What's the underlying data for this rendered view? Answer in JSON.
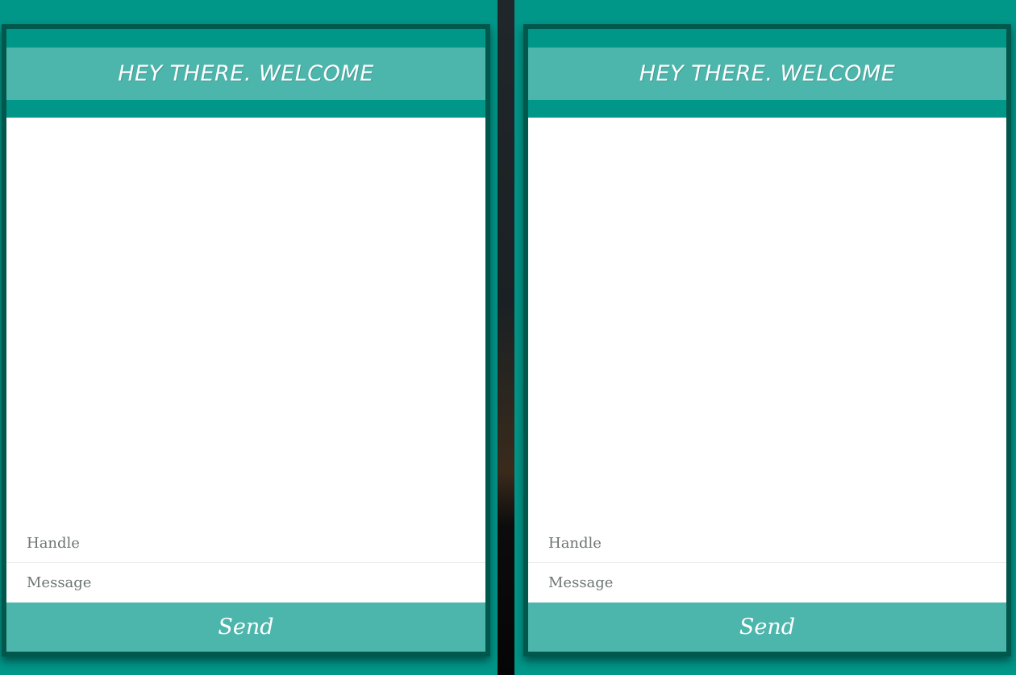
{
  "chats": [
    {
      "title": "HEY THERE. WELCOME",
      "handle_placeholder": "Handle",
      "message_placeholder": "Message",
      "send_label": "Send"
    },
    {
      "title": "HEY THERE. WELCOME",
      "handle_placeholder": "Handle",
      "message_placeholder": "Message",
      "send_label": "Send"
    }
  ],
  "colors": {
    "background": "#009688",
    "border": "#00574b",
    "accent": "#4db6ac",
    "panel": "#ffffff"
  }
}
